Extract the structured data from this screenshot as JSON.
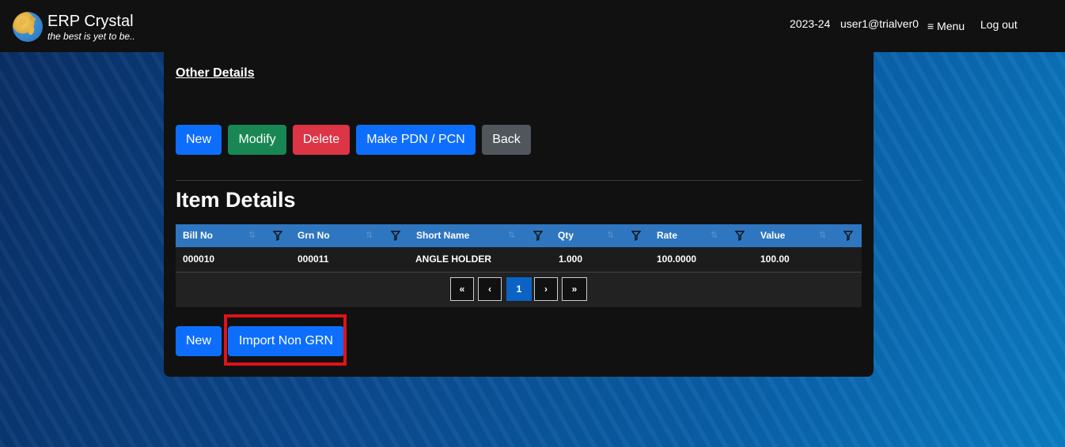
{
  "header": {
    "app_name": "ERP Crystal",
    "tagline": "the best is yet to be..",
    "year": "2023-24",
    "user": "user1@trialver0",
    "menu_label": "Menu",
    "logout_label": "Log out"
  },
  "card": {
    "other_details_label": "Other Details",
    "actions": {
      "new": "New",
      "modify": "Modify",
      "delete": "Delete",
      "make_pdn_pcn": "Make PDN / PCN",
      "back": "Back"
    },
    "item_details_title": "Item Details",
    "table": {
      "columns": [
        "Bill No",
        "Grn No",
        "Short Name",
        "Qty",
        "Rate",
        "Value"
      ],
      "rows": [
        [
          "000010",
          "000011",
          "ANGLE HOLDER",
          "1.000",
          "100.0000",
          "100.00"
        ]
      ],
      "pagination": {
        "first": "«",
        "prev": "‹",
        "current": "1",
        "next": "›",
        "last": "»"
      }
    },
    "bottom_actions": {
      "new": "New",
      "import_non_grn": "Import Non GRN"
    }
  },
  "colors": {
    "accent": "#0d6efd",
    "header_row": "#2f76c0",
    "highlight": "#e0121a"
  }
}
